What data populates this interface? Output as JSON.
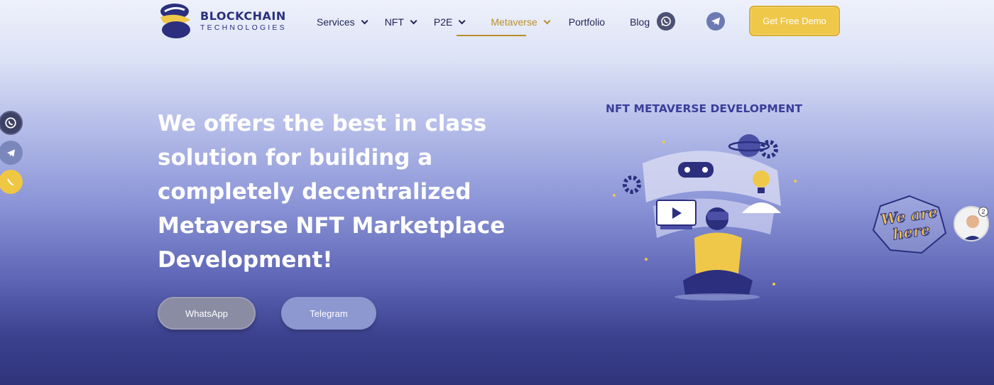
{
  "logo": {
    "title": "BLOCKCHAIN",
    "subtitle": "TECHNOLOGIES"
  },
  "nav": {
    "items": [
      {
        "label": "Services",
        "dropdown": true
      },
      {
        "label": "NFT",
        "dropdown": true
      },
      {
        "label": "P2E",
        "dropdown": true
      },
      {
        "label": "Metaverse",
        "dropdown": true,
        "active": true
      },
      {
        "label": "Portfolio",
        "dropdown": false
      },
      {
        "label": "Blog",
        "dropdown": false
      }
    ]
  },
  "header": {
    "whatsapp_icon": "whatsapp-icon",
    "telegram_icon": "telegram-icon",
    "demo_button": "Get Free Demo"
  },
  "side": {
    "icons": [
      "whatsapp-icon",
      "telegram-icon",
      "phone-icon"
    ]
  },
  "hero": {
    "title": "We offers the best in class solution for building a completely decentralized Metaverse NFT Marketplace Development!",
    "whatsapp_button": "WhatsApp",
    "telegram_button": "Telegram"
  },
  "illustration": {
    "title": "NFT METAVERSE DEVELOPMENT"
  },
  "chat": {
    "label": "We are here",
    "badge": "2"
  },
  "colors": {
    "accent": "#efc84a",
    "brand": "#2b2f7e",
    "active_nav": "#b8902a"
  }
}
